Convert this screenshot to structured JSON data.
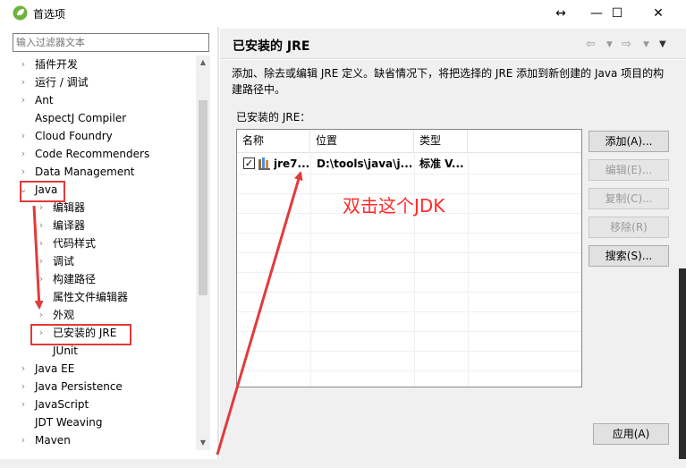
{
  "window": {
    "title": "首选项",
    "resize_glyph": "↔",
    "min_glyph": "—",
    "max_glyph": "☐",
    "close_glyph": "✕"
  },
  "filter": {
    "placeholder": "输入过滤器文本"
  },
  "tree": {
    "items": [
      {
        "label": "插件开发",
        "expanded": false,
        "level": 0
      },
      {
        "label": "运行 / 调试",
        "expanded": false,
        "level": 0
      },
      {
        "label": "Ant",
        "expanded": false,
        "level": 0
      },
      {
        "label": "AspectJ Compiler",
        "expanded": null,
        "level": 0
      },
      {
        "label": "Cloud Foundry",
        "expanded": false,
        "level": 0
      },
      {
        "label": "Code Recommenders",
        "expanded": false,
        "level": 0
      },
      {
        "label": "Data Management",
        "expanded": false,
        "level": 0
      },
      {
        "label": "Java",
        "expanded": true,
        "level": 0
      },
      {
        "label": "编辑器",
        "expanded": false,
        "level": 1
      },
      {
        "label": "编译器",
        "expanded": false,
        "level": 1
      },
      {
        "label": "代码样式",
        "expanded": false,
        "level": 1
      },
      {
        "label": "调试",
        "expanded": false,
        "level": 1
      },
      {
        "label": "构建路径",
        "expanded": false,
        "level": 1
      },
      {
        "label": "属性文件编辑器",
        "expanded": null,
        "level": 1
      },
      {
        "label": "外观",
        "expanded": false,
        "level": 1
      },
      {
        "label": "已安装的 JRE",
        "expanded": false,
        "level": 1
      },
      {
        "label": "JUnit",
        "expanded": null,
        "level": 1
      },
      {
        "label": "Java EE",
        "expanded": false,
        "level": 0
      },
      {
        "label": "Java Persistence",
        "expanded": false,
        "level": 0
      },
      {
        "label": "JavaScript",
        "expanded": false,
        "level": 0
      },
      {
        "label": "JDT Weaving",
        "expanded": null,
        "level": 0
      },
      {
        "label": "Maven",
        "expanded": false,
        "level": 0
      }
    ]
  },
  "page": {
    "title": "已安装的 JRE",
    "description": "添加、除去或编辑 JRE 定义。缺省情况下，将把选择的 JRE 添加到新创建的 Java 项目的构建路径中。",
    "installed_label": "已安装的 JRE：",
    "nav": {
      "back_icon": "⇦",
      "forward_icon": "⇨",
      "dropdown_icon": "▼",
      "menu_icon": "▼"
    }
  },
  "jre_table": {
    "columns": [
      "名称",
      "位置",
      "类型"
    ],
    "rows": [
      {
        "checked": true,
        "check_glyph": "✓",
        "name": "jre7...",
        "location": "D:\\tools\\java\\j...",
        "type": "标准 V..."
      }
    ]
  },
  "buttons": {
    "add": "添加(A)...",
    "edit": "编辑(E)...",
    "copy": "复制(C)...",
    "remove": "移除(R)",
    "search": "搜索(S)...",
    "apply": "应用(A)"
  },
  "annotation": {
    "text": "双击这个JDK",
    "color": "#ff2a2a"
  },
  "colors": {
    "accent_red": "#e23a3a",
    "panel_bg": "#f0f0f0"
  }
}
